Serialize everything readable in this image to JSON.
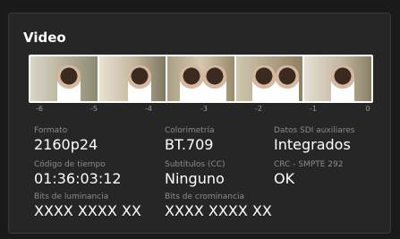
{
  "panel": {
    "title": "Video"
  },
  "timeline": {
    "ticks": [
      "-6",
      "-5",
      "-4",
      "-3",
      "-2",
      "-1",
      "0"
    ]
  },
  "fields": {
    "formato": {
      "label": "Formato",
      "value": "2160p24"
    },
    "colorimetria": {
      "label": "Colorimetría",
      "value": "BT.709"
    },
    "sdi": {
      "label": "Datos SDI auxiliares",
      "value": "Integrados"
    },
    "timecode": {
      "label": "Código de tiempo",
      "value": "01:36:03:12"
    },
    "subtitulos": {
      "label": "Subtítulos (CC)",
      "value": "Ninguno"
    },
    "crc": {
      "label": "CRC - SMPTE 292",
      "value": "OK"
    },
    "luma": {
      "label": "Bits de luminancia",
      "value": "XXXX XXXX XX"
    },
    "chroma": {
      "label": "Bits de crominancia",
      "value": "XXXX XXXX XX"
    }
  }
}
